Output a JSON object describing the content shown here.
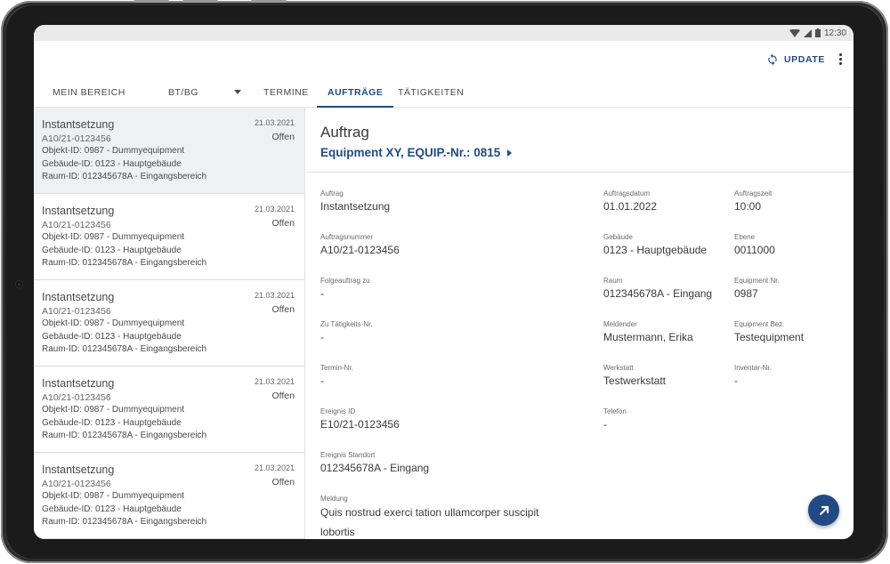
{
  "status_bar": {
    "time": "12:30"
  },
  "app_bar": {
    "update_label": "UPDATE"
  },
  "tabs": {
    "mein_bereich": "MEIN BEREICH",
    "bt_bg": "BT/BG",
    "termine": "TERMINE",
    "auftraege": "AUFTRÄGE",
    "taetigkeiten": "TÄTIGKEITEN",
    "active": "AUFTRÄGE"
  },
  "list": {
    "items": [
      {
        "title": "Instantsetzung",
        "number": "A10/21-0123456",
        "objekt": "Objekt-ID: 0987 - Dummyequipment",
        "gebaeude": "Gebäude-ID: 0123 - Hauptgebäude",
        "raum": "Raum-ID: 012345678A - Eingangsbereich",
        "date": "21.03.2021",
        "status": "Offen"
      },
      {
        "title": "Instantsetzung",
        "number": "A10/21-0123456",
        "objekt": "Objekt-ID: 0987 - Dummyequipment",
        "gebaeude": "Gebäude-ID: 0123 - Hauptgebäude",
        "raum": "Raum-ID: 012345678A - Eingangsbereich",
        "date": "21.03.2021",
        "status": "Offen"
      },
      {
        "title": "Instantsetzung",
        "number": "A10/21-0123456",
        "objekt": "Objekt-ID: 0987 - Dummyequipment",
        "gebaeude": "Gebäude-ID: 0123 - Hauptgebäude",
        "raum": "Raum-ID: 012345678A - Eingangsbereich",
        "date": "21.03.2021",
        "status": "Offen"
      },
      {
        "title": "Instantsetzung",
        "number": "A10/21-0123456",
        "objekt": "Objekt-ID: 0987 - Dummyequipment",
        "gebaeude": "Gebäude-ID: 0123 - Hauptgebäude",
        "raum": "Raum-ID: 012345678A - Eingangsbereich",
        "date": "21.03.2021",
        "status": "Offen"
      },
      {
        "title": "Instantsetzung",
        "number": "A10/21-0123456",
        "objekt": "Objekt-ID: 0987 - Dummyequipment",
        "gebaeude": "Gebäude-ID: 0123 - Hauptgebäude",
        "raum": "Raum-ID: 012345678A - Eingangsbereich",
        "date": "21.03.2021",
        "status": "Offen"
      }
    ]
  },
  "detail": {
    "title": "Auftrag",
    "equipment_link": "Equipment XY, EQUIP.-Nr.: 0815",
    "fields": {
      "auftrag": {
        "label": "Auftrag",
        "value": "Instantsetzung"
      },
      "auftragsnummer": {
        "label": "Auftragsnummer",
        "value": "A10/21-0123456"
      },
      "folgeauftrag": {
        "label": "Folgeauftrag zu",
        "value": "-"
      },
      "zu_taetigkeit": {
        "label": "Zu Tätigkeits-Nr.",
        "value": "-"
      },
      "termin_nr": {
        "label": "Termin-Nr.",
        "value": "-"
      },
      "ereignis_id": {
        "label": "Ereignis ID",
        "value": "E10/21-0123456"
      },
      "ereignis_standort": {
        "label": "Ereignis Standort",
        "value": "012345678A - Eingang"
      },
      "meldung": {
        "label": "Meldung",
        "value": "Quis nostrud exerci tation ullamcorper suscipit lobortis"
      },
      "auftragsdatum": {
        "label": "Auftragsdatum",
        "value": "01.01.2022"
      },
      "gebaeude": {
        "label": "Gebäude",
        "value": "0123 - Hauptgebäude"
      },
      "raum": {
        "label": "Raum",
        "value": "012345678A - Eingang"
      },
      "meldender": {
        "label": "Meldender",
        "value": "Mustermann, Erika"
      },
      "werkstatt": {
        "label": "Werkstatt",
        "value": "Testwerkstatt"
      },
      "telefon": {
        "label": "Telefon",
        "value": "-"
      },
      "auftragszeit": {
        "label": "Auftragszeit",
        "value": "10:00"
      },
      "ebene": {
        "label": "Ebene",
        "value": "0011000"
      },
      "equipment_nr": {
        "label": "Equipment Nr.",
        "value": "0987"
      },
      "equipment_bez": {
        "label": "Equipment Bez.",
        "value": "Testequipment"
      },
      "inventar_nr": {
        "label": "Inventar-Nr.",
        "value": "-"
      }
    }
  },
  "colors": {
    "accent": "#1f4a85",
    "selected_row": "#eef0f4"
  },
  "icons": {
    "update": "sync-icon",
    "more": "more-vert-icon",
    "fab": "arrow-up-right-icon",
    "link": "play-arrow-icon"
  }
}
